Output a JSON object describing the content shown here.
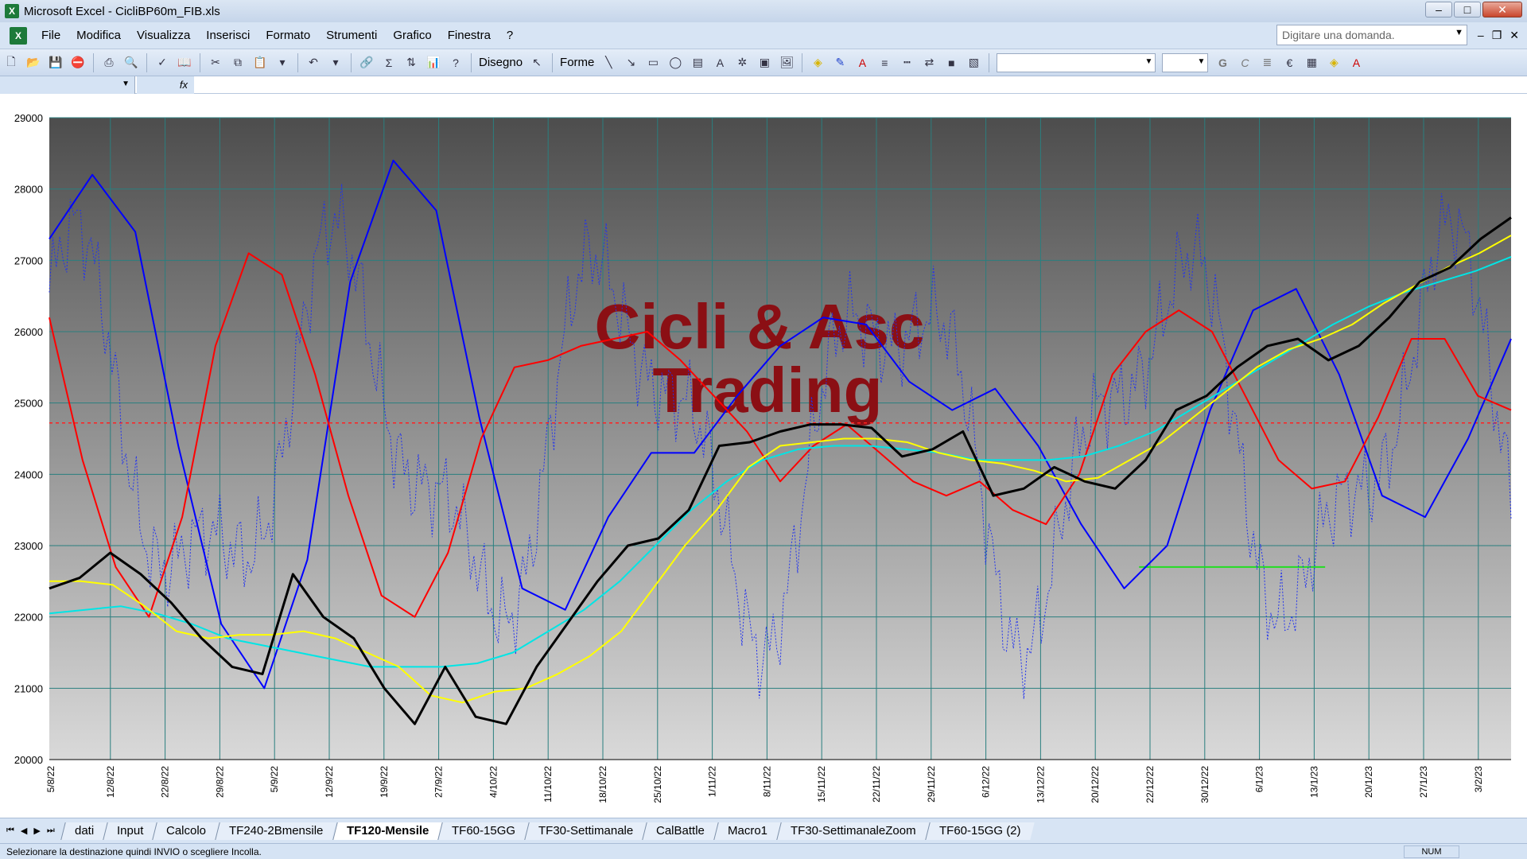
{
  "window": {
    "title": "Microsoft Excel - CicliBP60m_FIB.xls",
    "app_icon": "excel-icon"
  },
  "menu": {
    "items": [
      "File",
      "Modifica",
      "Visualizza",
      "Inserisci",
      "Formato",
      "Strumenti",
      "Grafico",
      "Finestra",
      "?"
    ],
    "help_placeholder": "Digitare una domanda."
  },
  "toolbar": {
    "disegno_label": "Disegno",
    "forme_label": "Forme"
  },
  "chart_data": {
    "type": "line",
    "watermark": [
      "Cicli & Asc",
      "Trading"
    ],
    "ylim": [
      20000,
      29000
    ],
    "y_ticks": [
      20000,
      21000,
      22000,
      23000,
      24000,
      25000,
      26000,
      27000,
      28000,
      29000
    ],
    "x_tick_labels": [
      "5/8/22",
      "12/8/22",
      "22/8/22",
      "29/8/22",
      "5/9/22",
      "12/9/22",
      "19/9/22",
      "27/9/22",
      "4/10/22",
      "11/10/22",
      "18/10/22",
      "25/10/22",
      "1/11/22",
      "8/11/22",
      "15/11/22",
      "22/11/22",
      "29/11/22",
      "6/12/22",
      "13/12/22",
      "20/12/22",
      "22/12/22",
      "30/12/22",
      "6/1/23",
      "13/1/23",
      "20/1/23",
      "27/1/23",
      "3/2/23"
    ],
    "horizontal_reference": 24720,
    "green_level": {
      "value": 22700,
      "from_index": 19.8,
      "to_index": 23.2
    },
    "series": [
      {
        "color": "#000000",
        "style": "solid-bold",
        "values": [
          22400,
          22550,
          22900,
          22600,
          22200,
          21700,
          21300,
          21200,
          22600,
          22000,
          21700,
          21000,
          20500,
          21300,
          20600,
          20500,
          21300,
          21900,
          22500,
          23000,
          23100,
          23500,
          24400,
          24450,
          24600,
          24700,
          24700,
          24650,
          24250,
          24350,
          24600,
          23700,
          23800,
          24100,
          23900,
          23800,
          24200,
          24900,
          25100,
          25500,
          25800,
          25900,
          25600,
          25800,
          26200,
          26700,
          26900,
          27300,
          27600
        ]
      },
      {
        "color": "#ffff00",
        "style": "solid",
        "values": [
          22500,
          22500,
          22450,
          22150,
          21800,
          21700,
          21750,
          21750,
          21800,
          21700,
          21500,
          21300,
          20900,
          20800,
          20950,
          21000,
          21200,
          21450,
          21800,
          22400,
          23000,
          23500,
          24100,
          24400,
          24450,
          24500,
          24500,
          24450,
          24300,
          24200,
          24150,
          24050,
          23900,
          23950,
          24200,
          24450,
          24800,
          25150,
          25500,
          25750,
          25900,
          26100,
          26400,
          26650,
          26900,
          27100,
          27350
        ]
      },
      {
        "color": "#00e5e5",
        "style": "solid",
        "values": [
          22050,
          22100,
          22150,
          22050,
          21900,
          21700,
          21600,
          21500,
          21400,
          21300,
          21300,
          21300,
          21350,
          21500,
          21800,
          22100,
          22500,
          23000,
          23500,
          23900,
          24200,
          24350,
          24400,
          24400,
          24350,
          24300,
          24200,
          24200,
          24200,
          24250,
          24400,
          24600,
          24900,
          25200,
          25500,
          25800,
          26100,
          26350,
          26550,
          26700,
          26850,
          27050
        ]
      },
      {
        "color": "#ff0000",
        "style": "solid",
        "values": [
          26200,
          24200,
          22700,
          22000,
          23400,
          25800,
          27100,
          26800,
          25400,
          23700,
          22300,
          22000,
          22900,
          24500,
          25500,
          25600,
          25800,
          25900,
          26000,
          25600,
          25100,
          24600,
          23900,
          24400,
          24700,
          24300,
          23900,
          23700,
          23900,
          23500,
          23300,
          24000,
          25400,
          26000,
          26300,
          26000,
          25100,
          24200,
          23800,
          23900,
          24800,
          25900,
          25900,
          25100,
          24900
        ]
      },
      {
        "color": "#0000ff",
        "style": "solid",
        "values": [
          27300,
          28200,
          27400,
          24400,
          21900,
          21000,
          22800,
          26700,
          28400,
          27700,
          24800,
          22400,
          22100,
          23400,
          24300,
          24300,
          25100,
          25800,
          26200,
          26100,
          25300,
          24900,
          25200,
          24400,
          23300,
          22400,
          23000,
          24900,
          26300,
          26600,
          25400,
          23700,
          23400,
          24500,
          25900
        ]
      }
    ]
  },
  "sheet_tabs": [
    "dati",
    "Input",
    "Calcolo",
    "TF240-2Bmensile",
    "TF120-Mensile",
    "TF60-15GG",
    "TF30-Settimanale",
    "CalBattle",
    "Macro1",
    "TF30-SettimanaleZoom",
    "TF60-15GG (2)"
  ],
  "active_tab": "TF120-Mensile",
  "status": {
    "message": "Selezionare la destinazione quindi INVIO o scegliere Incolla.",
    "num": "NUM"
  }
}
